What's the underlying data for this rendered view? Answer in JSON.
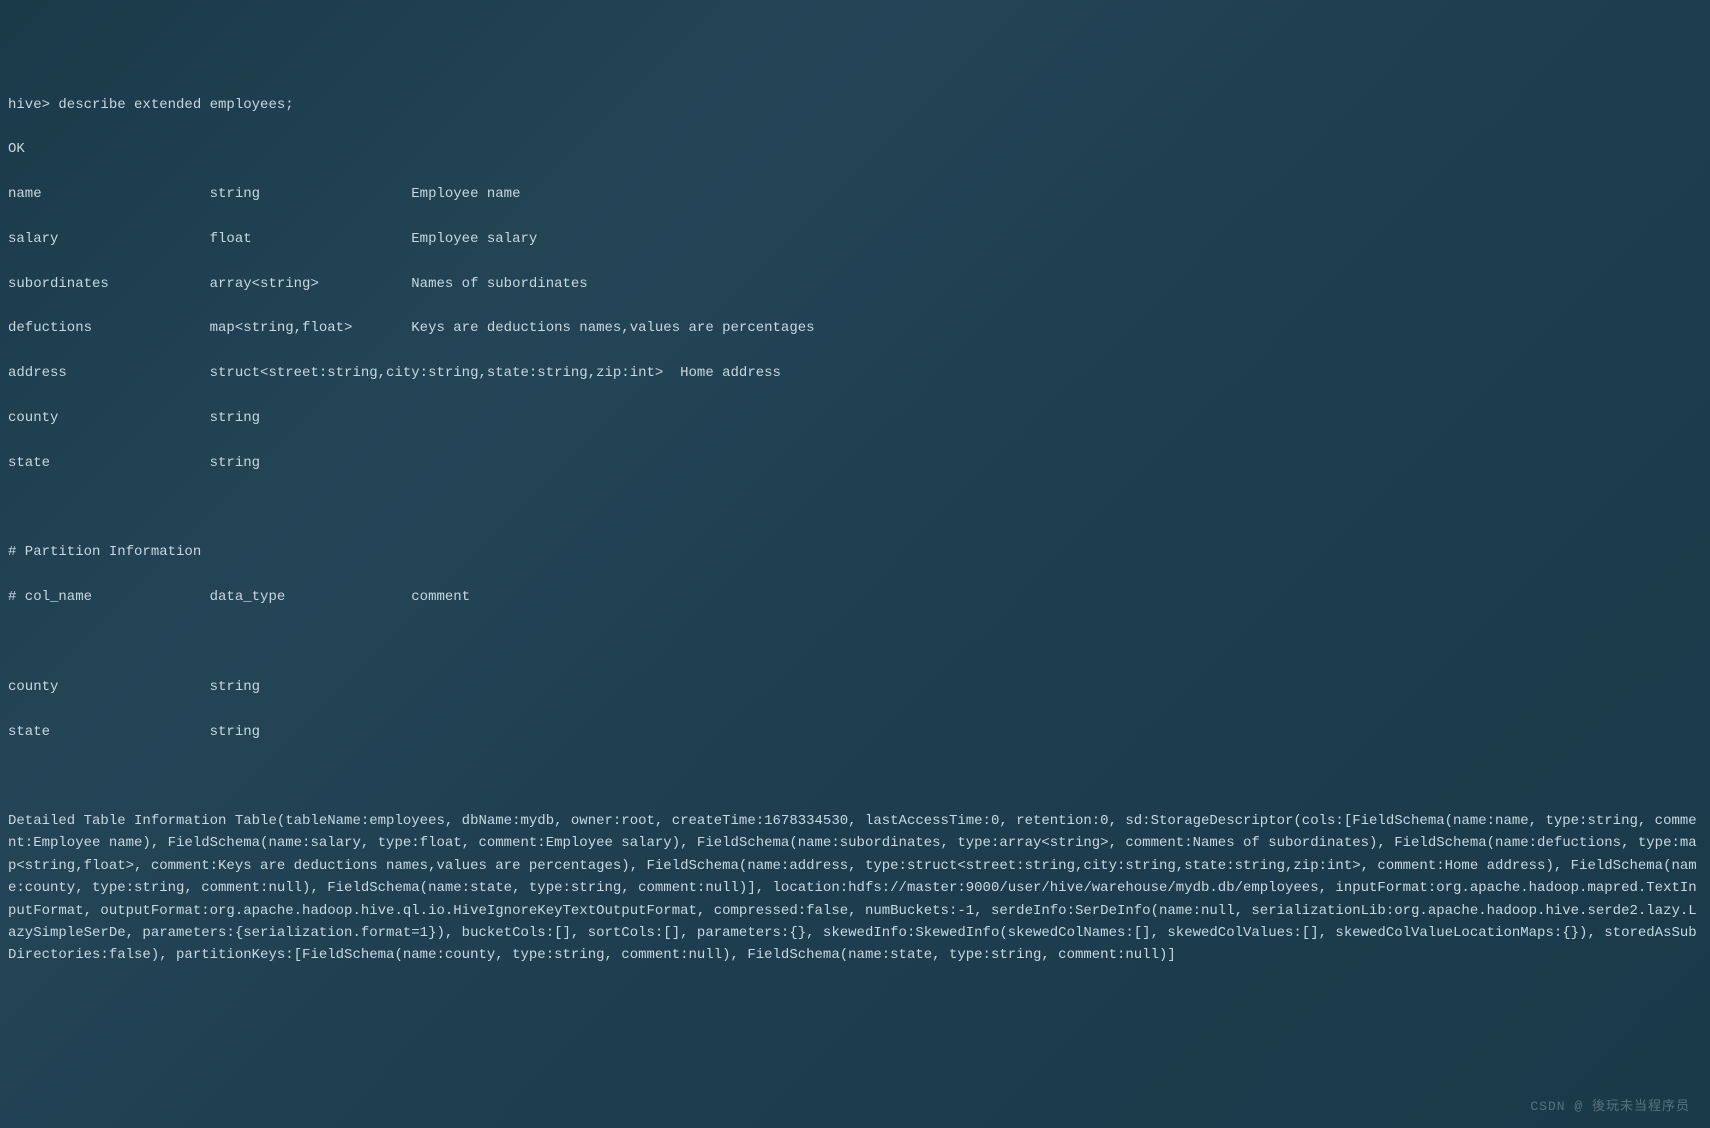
{
  "terminal": {
    "prompt_line": "hive> describe extended employees;",
    "ok": "OK",
    "columns": [
      {
        "name": "name",
        "type": "string",
        "comment": "Employee name"
      },
      {
        "name": "salary",
        "type": "float",
        "comment": "Employee salary"
      },
      {
        "name": "subordinates",
        "type": "array<string>",
        "comment": "Names of subordinates"
      },
      {
        "name": "defuctions",
        "type": "map<string,float>",
        "comment": "Keys are deductions names,values are percentages"
      },
      {
        "name": "address",
        "type": "struct<street:string,city:string,state:string,zip:int>",
        "comment": "Home address"
      },
      {
        "name": "county",
        "type": "string",
        "comment": ""
      },
      {
        "name": "state",
        "type": "string",
        "comment": ""
      }
    ],
    "partition_header": "# Partition Information",
    "partition_col_header": {
      "name": "# col_name",
      "type": "data_type",
      "comment": "comment"
    },
    "partitions": [
      {
        "name": "county",
        "type": "string",
        "comment": ""
      },
      {
        "name": "state",
        "type": "string",
        "comment": ""
      }
    ],
    "detailed_label": "Detailed Table Information",
    "detailed_info": "Table(tableName:employees, dbName:mydb, owner:root, createTime:1678334530, lastAccessTime:0, retention:0, sd:StorageDescriptor(cols:[FieldSchema(name:name, type:string, comment:Employee name), FieldSchema(name:salary, type:float, comment:Employee salary), FieldSchema(name:subordinates, type:array<string>, comment:Names of subordinates), FieldSchema(name:defuctions, type:map<string,float>, comment:Keys are deductions names,values are percentages), FieldSchema(name:address, type:struct<street:string,city:string,state:string,zip:int>, comment:Home address), FieldSchema(name:county, type:string, comment:null), FieldSchema(name:state, type:string, comment:null)], location:hdfs://master:9000/user/hive/warehouse/mydb.db/employees, inputFormat:org.apache.hadoop.mapred.TextInputFormat, outputFormat:org.apache.hadoop.hive.ql.io.HiveIgnoreKeyTextOutputFormat, compressed:false, numBuckets:-1, serdeInfo:SerDeInfo(name:null, serializationLib:org.apache.hadoop.hive.serde2.lazy.LazySimpleSerDe, parameters:{serialization.format=1}), bucketCols:[], sortCols:[], parameters:{}, skewedInfo:SkewedInfo(skewedColNames:[], skewedColValues:[], skewedColValueLocationMaps:{}), storedAsSubDirectories:false), partitionKeys:[FieldSchema(name:county, type:string, comment:null), FieldSchema(name:state, type:string, comment:null)]",
    "watermark": "CSDN @ 後玩未当程序员"
  }
}
